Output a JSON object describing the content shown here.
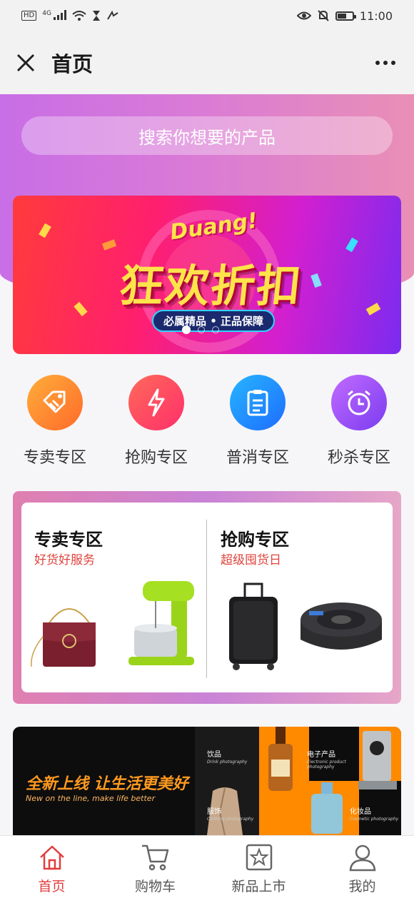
{
  "status": {
    "network": "4G",
    "time": "11:00",
    "hd": "HD"
  },
  "nav": {
    "title": "首页"
  },
  "search": {
    "placeholder": "搜索你想要的产品"
  },
  "banner": {
    "top_text": "Duang!",
    "headline": "狂欢折扣",
    "pill": "必属精品 • 正品保障",
    "slides": 3,
    "active_slide": 1
  },
  "categories": [
    {
      "label": "专卖专区",
      "icon": "tag-icon",
      "color": "#ff8a2a"
    },
    {
      "label": "抢购专区",
      "icon": "lightning-icon",
      "color": "#ff4d5e"
    },
    {
      "label": "普消专区",
      "icon": "clipboard-icon",
      "color": "#1e90ff"
    },
    {
      "label": "秒杀专区",
      "icon": "alarm-clock-icon",
      "color": "#9b4ff0"
    }
  ],
  "promos": [
    {
      "title": "专卖专区",
      "subtitle": "好货好服务",
      "items": [
        "handbag-image",
        "stand-mixer-image"
      ]
    },
    {
      "title": "抢购专区",
      "subtitle": "超级囤货日",
      "items": [
        "suitcase-image",
        "induction-cooker-image"
      ]
    }
  ],
  "banner2": {
    "slogan": "全新上线 让生活更美好",
    "subtitle": "New on the line, make life better",
    "tiles": [
      {
        "label": "饮品",
        "sub": "Drink photography"
      },
      {
        "label": "电子产品",
        "sub": "Electronic product photography"
      },
      {
        "label": "服饰",
        "sub": "Clothing photography"
      },
      {
        "label": "化妆品",
        "sub": "Cosmetic photography"
      }
    ]
  },
  "tabs": [
    {
      "label": "首页",
      "icon": "home-icon",
      "active": true
    },
    {
      "label": "购物车",
      "icon": "cart-icon",
      "active": false
    },
    {
      "label": "新品上市",
      "icon": "star-badge-icon",
      "active": false
    },
    {
      "label": "我的",
      "icon": "user-icon",
      "active": false
    }
  ],
  "colors": {
    "accent": "#e23d3d",
    "hero_start": "#c86ee6",
    "hero_end": "#e98fb6"
  }
}
